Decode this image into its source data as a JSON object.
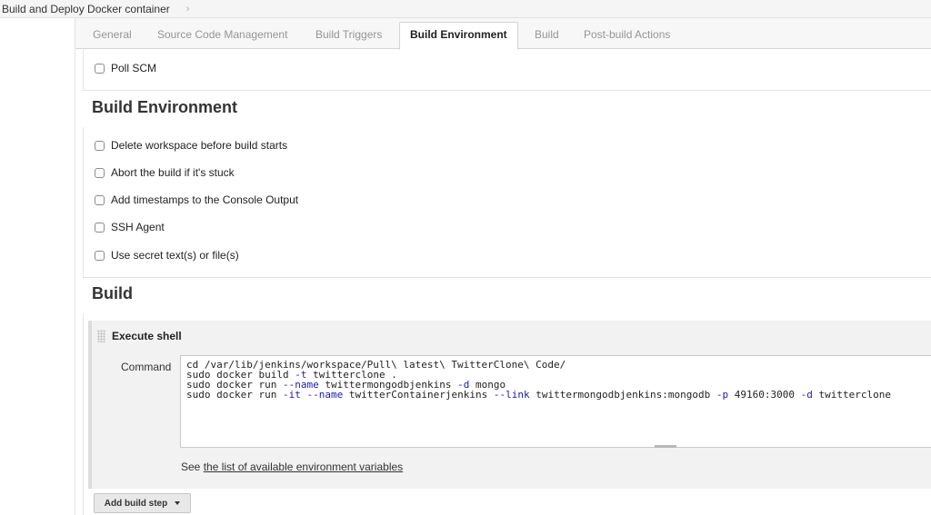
{
  "breadcrumb": {
    "job": "Build and Deploy Docker container",
    "separator": "›"
  },
  "tabs": [
    {
      "label": "General"
    },
    {
      "label": "Source Code Management"
    },
    {
      "label": "Build Triggers"
    },
    {
      "label": "Build Environment",
      "active": true
    },
    {
      "label": "Build"
    },
    {
      "label": "Post-build Actions"
    }
  ],
  "triggers": {
    "poll_scm": "Poll SCM"
  },
  "build_env": {
    "title": "Build Environment",
    "options": [
      "Delete workspace before build starts",
      "Abort the build if it's stuck",
      "Add timestamps to the Console Output",
      "SSH Agent",
      "Use secret text(s) or file(s)"
    ]
  },
  "build": {
    "title": "Build",
    "step_title": "Execute shell",
    "command_label": "Command",
    "command_lines": [
      "cd /var/lib/jenkins/workspace/Pull\\ latest\\ TwitterClone\\ Code/",
      "sudo docker build -t twitterclone .",
      "sudo docker run --name twittermongodbjenkins -d mongo",
      "sudo docker run -it --name twitterContainerjenkins --link twittermongodbjenkins:mongodb -p 49160:3000 -d twitterclone"
    ],
    "see_prefix": "See",
    "env_link": "the list of available environment variables",
    "add_step": "Add build step"
  }
}
